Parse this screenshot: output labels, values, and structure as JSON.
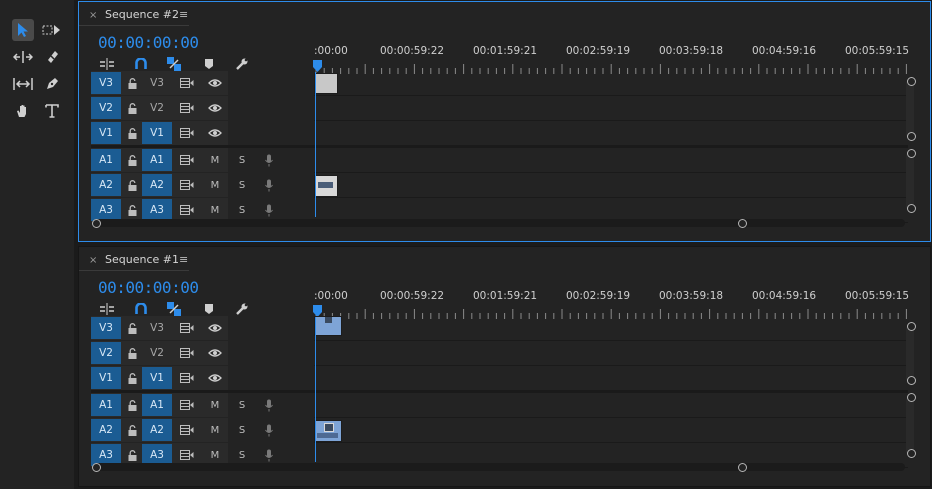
{
  "tools": [
    {
      "name": "selection-tool",
      "active": true
    },
    {
      "name": "track-select-forward-tool",
      "active": false
    },
    {
      "name": "ripple-edit-tool",
      "active": false
    },
    {
      "name": "razor-tool",
      "active": false
    },
    {
      "name": "slip-tool",
      "active": false
    },
    {
      "name": "pen-tool",
      "active": false
    },
    {
      "name": "hand-tool",
      "active": false
    },
    {
      "name": "type-tool",
      "active": false
    }
  ],
  "timelines": [
    {
      "close_symbol": "×",
      "name": "Sequence #2",
      "menu_symbol": "≡",
      "timecode": "00:00:00:00",
      "focused": true,
      "ruler": [
        ":00:00",
        "00:00:59:22",
        "00:01:59:21",
        "00:02:59:19",
        "00:03:59:18",
        "00:04:59:16",
        "00:05:59:15"
      ],
      "video_tracks": [
        {
          "src": "V3",
          "src_on": true,
          "target": "V3",
          "target_on": false
        },
        {
          "src": "V2",
          "src_on": true,
          "target": "V2",
          "target_on": false
        },
        {
          "src": "V1",
          "src_on": true,
          "target": "V1",
          "target_on": true
        }
      ],
      "audio_tracks": [
        {
          "src": "A1",
          "src_on": true,
          "target": "A1",
          "target_on": true,
          "mute": "M",
          "solo": "S"
        },
        {
          "src": "A2",
          "src_on": true,
          "target": "A2",
          "target_on": true,
          "mute": "M",
          "solo": "S"
        },
        {
          "src": "A3",
          "src_on": true,
          "target": "A3",
          "target_on": true,
          "mute": "M",
          "solo": "S"
        }
      ],
      "clips": [
        {
          "track": "V3",
          "style": "gray"
        },
        {
          "track": "A2",
          "style": "bluegray"
        }
      ]
    },
    {
      "close_symbol": "×",
      "name": "Sequence #1",
      "menu_symbol": "≡",
      "timecode": "00:00:00:00",
      "focused": false,
      "ruler": [
        ":00:00",
        "00:00:59:22",
        "00:01:59:21",
        "00:02:59:19",
        "00:03:59:18",
        "00:04:59:16",
        "00:05:59:15"
      ],
      "video_tracks": [
        {
          "src": "V3",
          "src_on": true,
          "target": "V3",
          "target_on": false
        },
        {
          "src": "V2",
          "src_on": true,
          "target": "V2",
          "target_on": false
        },
        {
          "src": "V1",
          "src_on": true,
          "target": "V1",
          "target_on": true
        }
      ],
      "audio_tracks": [
        {
          "src": "A1",
          "src_on": true,
          "target": "A1",
          "target_on": true,
          "mute": "M",
          "solo": "S"
        },
        {
          "src": "A2",
          "src_on": true,
          "target": "A2",
          "target_on": true,
          "mute": "M",
          "solo": "S"
        },
        {
          "src": "A3",
          "src_on": true,
          "target": "A3",
          "target_on": true,
          "mute": "M",
          "solo": "S"
        }
      ],
      "clips": [
        {
          "track": "V3",
          "style": "blue"
        },
        {
          "track": "A2",
          "style": "blue"
        }
      ]
    }
  ],
  "colors": {
    "accent": "#2d8ceb",
    "target": "#1b5c93",
    "clip_gray": "#c8c8c8",
    "clip_blue": "#7ea4d6",
    "clip_bluegray": "#5a6f8a"
  }
}
